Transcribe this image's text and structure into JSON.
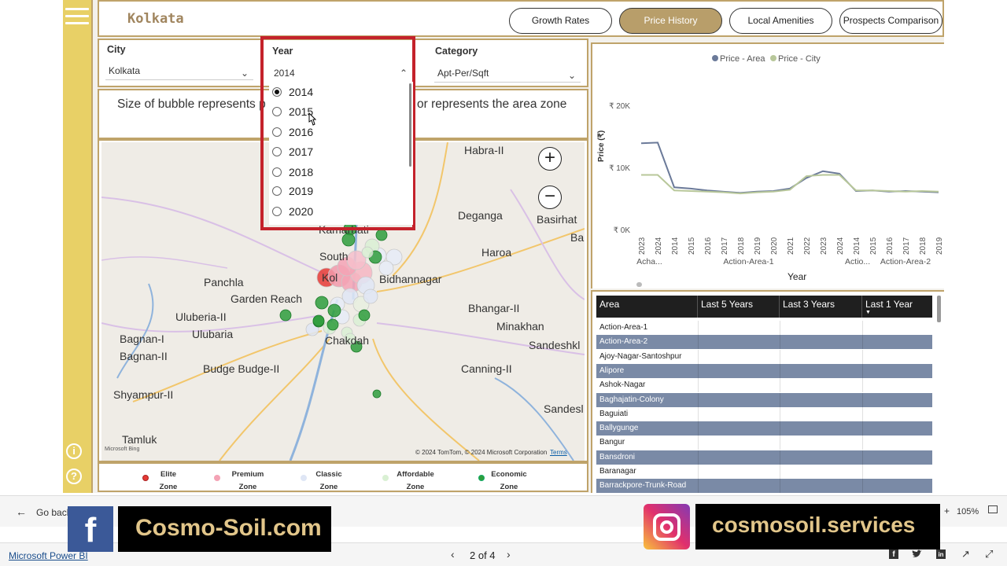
{
  "report": {
    "title": "Kolkata",
    "tabs": [
      "Growth Rates",
      "Price History",
      "Local Amenities",
      "Prospects Comparison"
    ],
    "active_tab": "Price History"
  },
  "filters": {
    "city": {
      "label": "City",
      "value": "Kolkata"
    },
    "year": {
      "label": "Year",
      "value": "2014",
      "options": [
        "2014",
        "2015",
        "2016",
        "2017",
        "2018",
        "2019",
        "2020"
      ],
      "selected": "2014"
    },
    "category": {
      "label": "Category",
      "value": "Apt-Per/Sqft"
    }
  },
  "note": {
    "left": "Size of bubble represents p",
    "right": "or represents the area zone"
  },
  "map": {
    "places": [
      "Habra-II",
      "Deganga",
      "Basirhat",
      "Ba",
      "Haroa",
      "Bidhannagar",
      "Panchla",
      "Garden Reach",
      "Uluberia-II",
      "Ulubaria",
      "Bagnan-I",
      "Bagnan-II",
      "Budge Budge-II",
      "Shyampur-II",
      "Tamluk",
      "Bhangar-II",
      "Minakhan",
      "Sandeshkl",
      "Canning-II",
      "Sandesl",
      "Kamarhati",
      "South",
      "Kol",
      "Chakdah"
    ],
    "attribution": "© 2024 TomTom, © 2024 Microsoft Corporation",
    "terms": "Terms",
    "bing": "Microsoft Bing",
    "zoom_in": "+",
    "zoom_out": "−"
  },
  "legend": [
    {
      "line1": "Elite",
      "line2": "Zone",
      "color": "#e53935"
    },
    {
      "line1": "Premium",
      "line2": "Zone",
      "color": "#f4a3b5"
    },
    {
      "line1": "Classic",
      "line2": "Zone",
      "color": "#dfe6f5"
    },
    {
      "line1": "Affordable",
      "line2": "Zone",
      "color": "#d9f0d3"
    },
    {
      "line1": "Economic",
      "line2": "Zone",
      "color": "#2e9e3c"
    }
  ],
  "chart_data": {
    "type": "line",
    "legend": [
      "Price - Area",
      "Price - City"
    ],
    "legend_colors": [
      "#6b7a99",
      "#b8c79a"
    ],
    "ylabel": "Price (₹)",
    "xlabel": "Year",
    "y_ticks": [
      "₹ 20K",
      "₹ 10K",
      "₹ 0K"
    ],
    "ylim": [
      0,
      20000
    ],
    "x_ticks": [
      "2023",
      "2024",
      "2014",
      "2015",
      "2016",
      "2017",
      "2018",
      "2019",
      "2020",
      "2021",
      "2022",
      "2023",
      "2024",
      "2014",
      "2015",
      "2016",
      "2017",
      "2018",
      "2019"
    ],
    "groups": [
      {
        "label": "Acha...",
        "start": 0,
        "count": 2
      },
      {
        "label": "Action-Area-1",
        "start": 2,
        "count": 11
      },
      {
        "label": "Actio...",
        "start": 13,
        "count": 1
      },
      {
        "label": "Action-Area-2",
        "start": 13,
        "count": 6
      }
    ],
    "series": [
      {
        "name": "Price - Area",
        "values": [
          13900,
          14000,
          6800,
          6600,
          6300,
          6100,
          5900,
          6100,
          6200,
          6600,
          8300,
          9400,
          9000,
          6200,
          6300,
          6100,
          6200,
          6100,
          6000
        ]
      },
      {
        "name": "Price - City",
        "values": [
          8800,
          8800,
          6300,
          6200,
          6100,
          6000,
          5800,
          6000,
          6100,
          6400,
          8600,
          8800,
          8800,
          6300,
          6300,
          6200,
          6100,
          6200,
          6100
        ]
      }
    ]
  },
  "table": {
    "headers": [
      "Area",
      "Last 5 Years",
      "Last 3 Years",
      "Last 1 Year"
    ],
    "rows": [
      "Action-Area-1",
      "Action-Area-2",
      "Ajoy-Nagar-Santoshpur",
      "Alipore",
      "Ashok-Nagar",
      "Baghajatin-Colony",
      "Baguiati",
      "Ballygunge",
      "Bangur",
      "Bansdroni",
      "Baranagar",
      "Barrackpore-Trunk-Road"
    ]
  },
  "powerbi": {
    "go_back": "Go back",
    "app_name": "Microsoft Power BI",
    "page_indicator": "2 of 4",
    "zoom": "105%"
  },
  "banners": {
    "left": "Cosmo-Soil.com",
    "right": "cosmosoil.services"
  }
}
